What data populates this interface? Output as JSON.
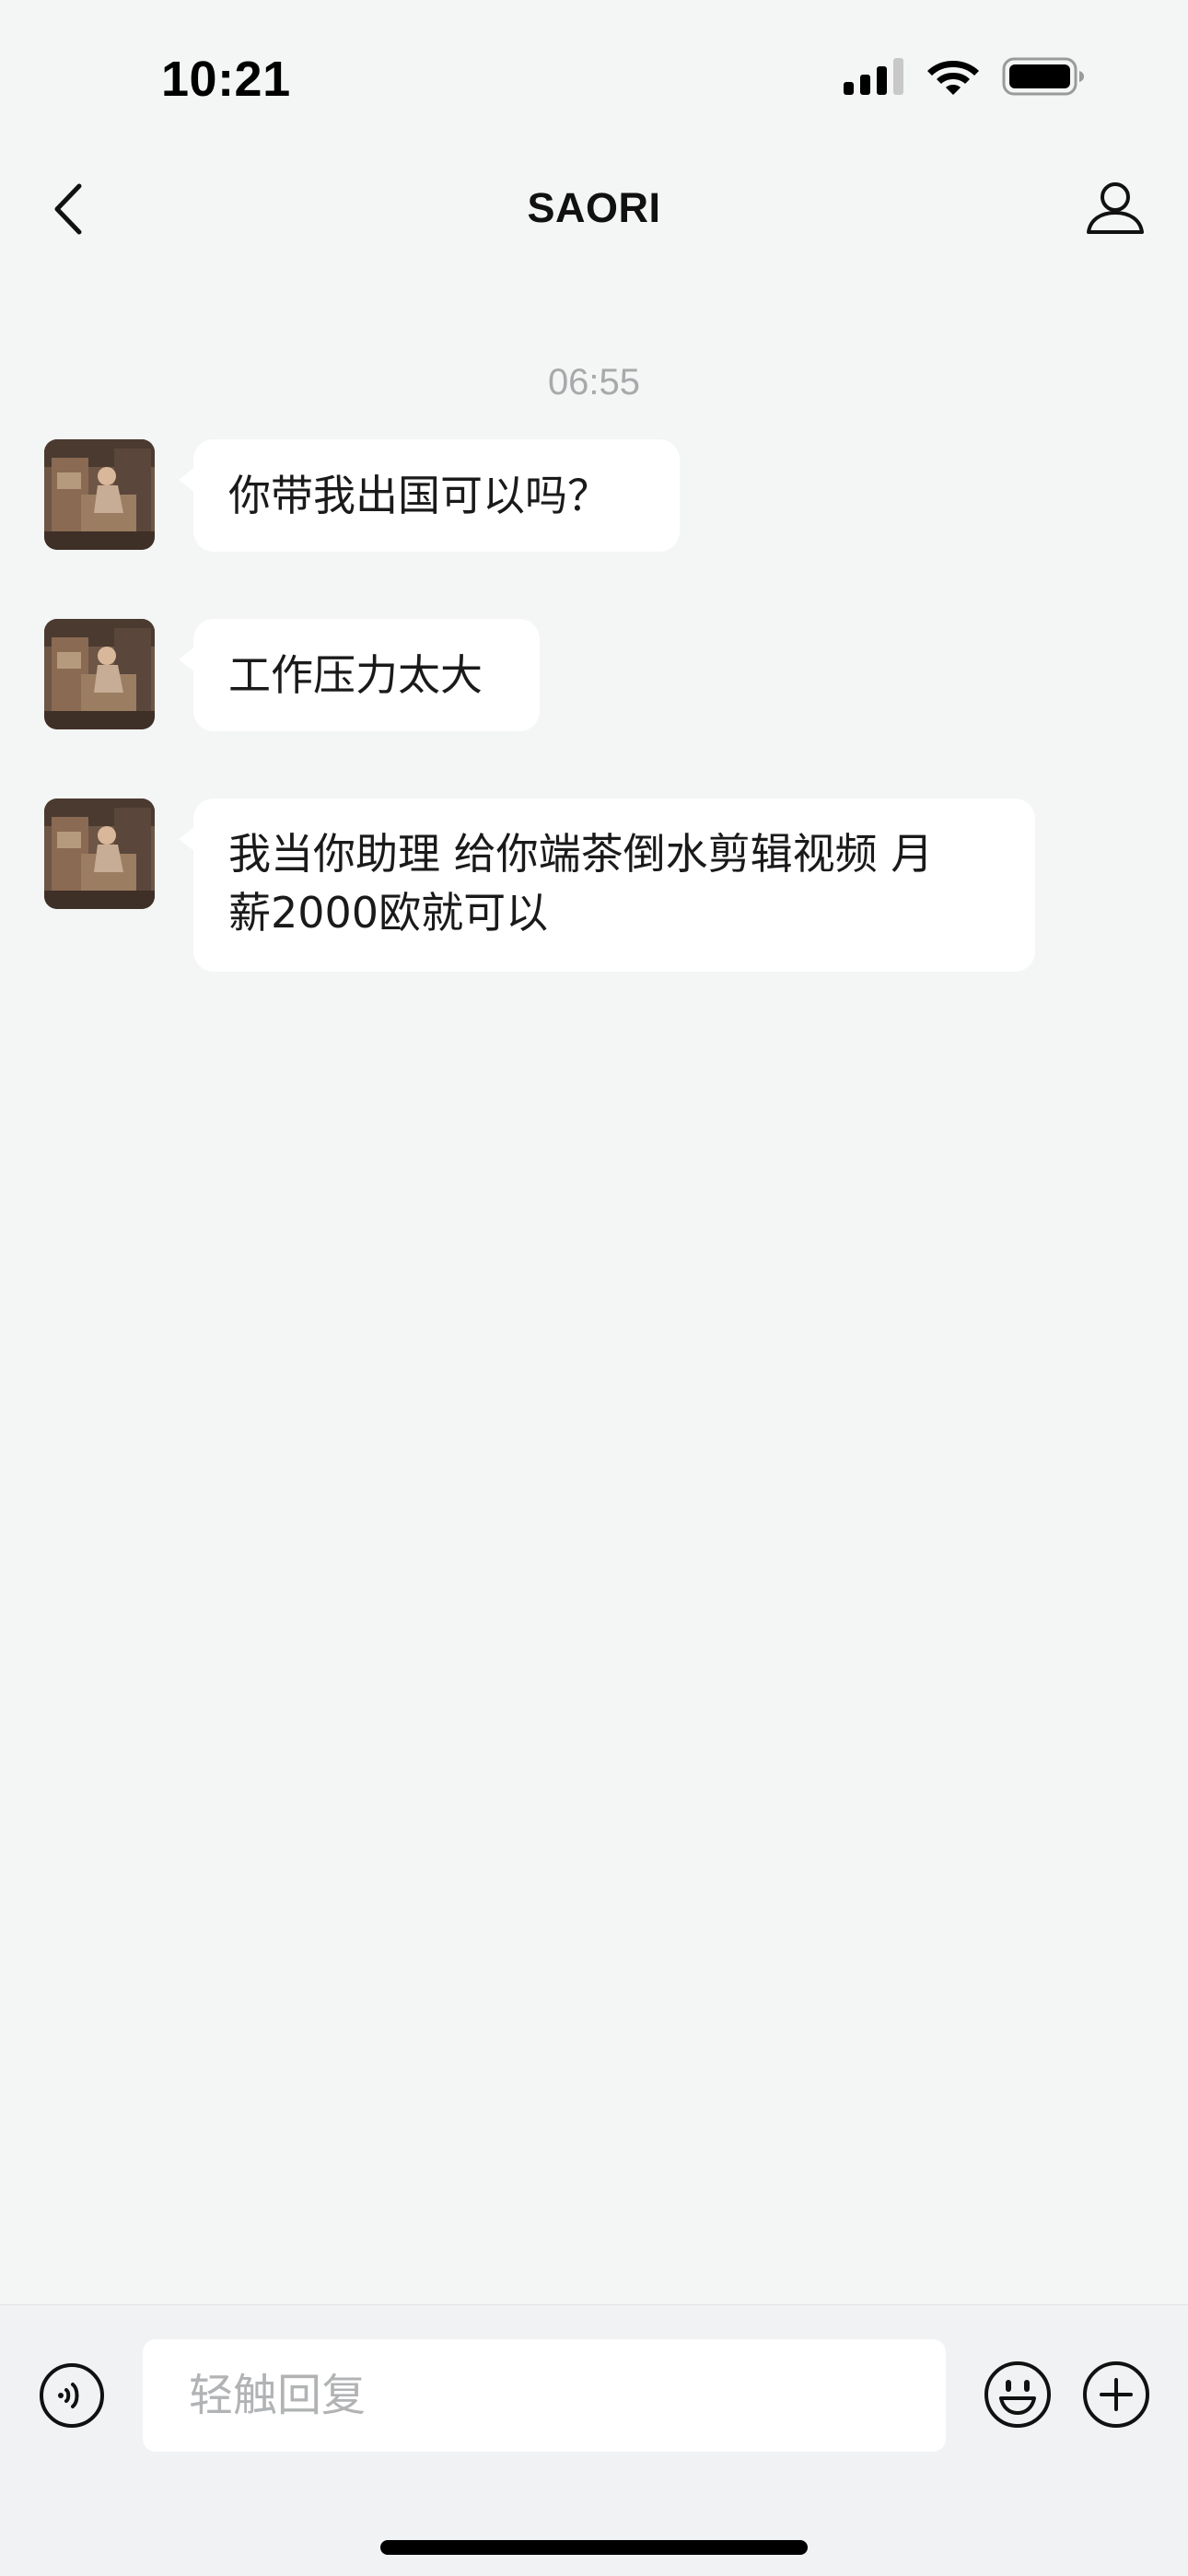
{
  "status_bar": {
    "time": "10:21",
    "icons": [
      "cellular-signal-icon",
      "wifi-icon",
      "battery-icon"
    ]
  },
  "nav": {
    "title": "SAORI",
    "back_icon": "chevron-left-icon",
    "profile_icon": "person-icon"
  },
  "chat": {
    "timestamp": "06:55",
    "messages": [
      {
        "text": "你带我出国可以吗？"
      },
      {
        "text": "工作压力太大"
      },
      {
        "line1": "我当你助理 给你端茶倒水剪辑视频 月",
        "line2": "薪2000欧就可以"
      }
    ]
  },
  "input_bar": {
    "placeholder": "轻触回复",
    "voice_icon": "voice-icon",
    "emoji_icon": "smiley-icon",
    "add_icon": "plus-circle-icon"
  },
  "colors": {
    "background": "#f4f5f5",
    "bubble": "#ffffff",
    "timestamp": "#a7a9ab",
    "placeholder": "#b1b3b5"
  }
}
